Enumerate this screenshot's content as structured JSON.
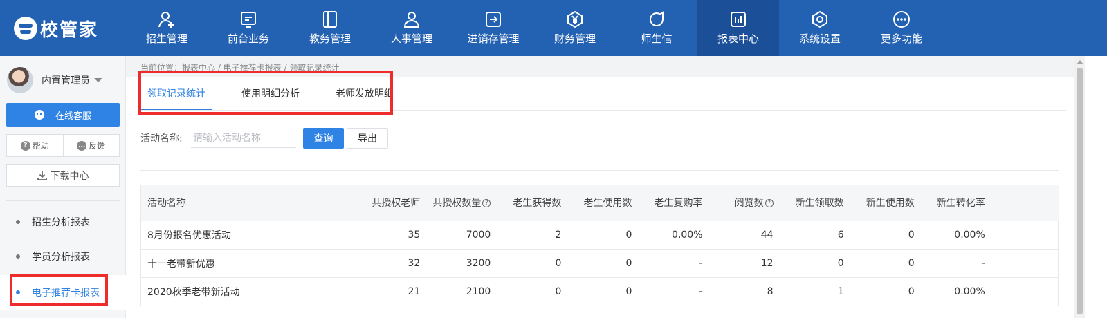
{
  "app": {
    "logo_text": "校管家"
  },
  "nav": [
    {
      "label": "招生管理",
      "icon": "user-plus-icon"
    },
    {
      "label": "前台业务",
      "icon": "monitor-icon"
    },
    {
      "label": "教务管理",
      "icon": "book-icon"
    },
    {
      "label": "人事管理",
      "icon": "person-icon"
    },
    {
      "label": "进销存管理",
      "icon": "arrow-box-icon"
    },
    {
      "label": "财务管理",
      "icon": "yen-hexagon-icon"
    },
    {
      "label": "师生信",
      "icon": "chat-icon"
    },
    {
      "label": "报表中心",
      "icon": "chart-icon",
      "active": true
    },
    {
      "label": "系统设置",
      "icon": "settings-icon"
    },
    {
      "label": "更多功能",
      "icon": "more-icon"
    }
  ],
  "sidebar": {
    "user_name": "内置管理员",
    "service_label": "在线客服",
    "help_label": "帮助",
    "feedback_label": "反馈",
    "download_label": "下载中心",
    "items": [
      {
        "label": "招生分析报表"
      },
      {
        "label": "学员分析报表"
      },
      {
        "label": "电子推荐卡报表",
        "active": true
      }
    ]
  },
  "breadcrumb": "当前位置：报表中心 / 电子推荐卡报表 / 领取记录统计",
  "tabs": [
    {
      "label": "领取记录统计",
      "active": true
    },
    {
      "label": "使用明细分析"
    },
    {
      "label": "老师发放明细"
    }
  ],
  "filter": {
    "label": "活动名称:",
    "placeholder": "请输入活动名称",
    "value": "",
    "query_label": "查询",
    "export_label": "导出"
  },
  "table": {
    "headers": [
      "活动名称",
      "共授权老师",
      "共授权数量",
      "老生获得数",
      "老生使用数",
      "老生复购率",
      "阅览数",
      "新生领取数",
      "新生使用数",
      "新生转化率"
    ],
    "rows": [
      [
        "8月份报名优惠活动",
        "35",
        "7000",
        "2",
        "0",
        "0.00%",
        "44",
        "6",
        "0",
        "0.00%"
      ],
      [
        "十一老带新优惠",
        "32",
        "3200",
        "0",
        "0",
        "-",
        "12",
        "0",
        "0",
        "-"
      ],
      [
        "2020秋季老带新活动",
        "21",
        "2100",
        "0",
        "0",
        "-",
        "8",
        "1",
        "0",
        "0.00%"
      ]
    ]
  },
  "colors": {
    "topbar": "#2361b2",
    "topbar_active": "#1b4f98",
    "accent": "#2f83e4",
    "highlight_box": "#ee2c2c"
  }
}
